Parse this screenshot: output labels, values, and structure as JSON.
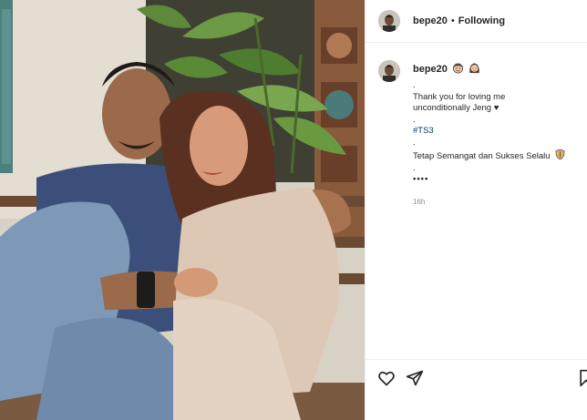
{
  "post": {
    "username": "bepe20",
    "separator": "•",
    "follow_status": "Following"
  },
  "caption": {
    "username": "bepe20",
    "emojis": [
      "man-face-emoji",
      "woman-face-emoji"
    ],
    "lines": [
      ".",
      "Thank you for loving me",
      "unconditionally Jeng ♥",
      ".",
      "#TS3",
      ".",
      "Tetap Semangat dan Sukses Selalu",
      ".",
      "••••"
    ],
    "hashtag": "#TS3",
    "timestamp": "16h"
  },
  "actions": {
    "icons": [
      "heart-icon",
      "share-icon",
      "bookmark-icon"
    ]
  },
  "colors": {
    "hashtag": "#00376b",
    "text": "#262626",
    "muted": "#8e8e8e",
    "border": "#efefef"
  }
}
